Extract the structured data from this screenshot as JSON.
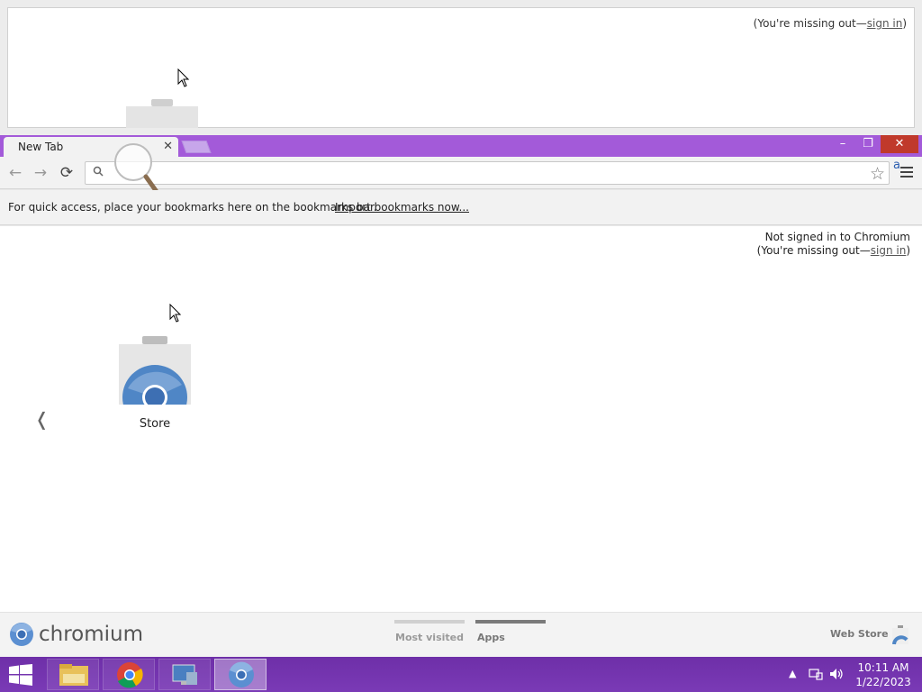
{
  "background_window": {
    "missing_out": "(You're missing out—",
    "sign_in": "sign in",
    "close_paren": ")"
  },
  "tab": {
    "title": "New Tab",
    "close": "✕"
  },
  "window_controls": {
    "minimize": "–",
    "restore": "❐",
    "close": "✕"
  },
  "toolbar": {
    "back": "←",
    "forward": "→",
    "reload": "⟳",
    "omnibox_value": "",
    "star": "☆",
    "extension_letter": "a"
  },
  "bookmarks_bar": {
    "prompt": "For quick access, place your bookmarks here on the bookmarks bar.",
    "import_link": "Import bookmarks now..."
  },
  "ntp": {
    "signin_status": "Not signed in to Chromium",
    "missing_out": "(You're missing out—",
    "sign_in": "sign in",
    "close_paren": ")",
    "prev_arrow": "❬",
    "apps": [
      {
        "label": "Store"
      }
    ]
  },
  "footer": {
    "brand": "chromium",
    "pages": [
      {
        "label": "Most visited",
        "active": false
      },
      {
        "label": "Apps",
        "active": true
      }
    ],
    "web_store": "Web Store"
  },
  "taskbar": {
    "clock_time": "10:11 AM",
    "clock_date": "1/22/2023",
    "tray_up": "▲"
  },
  "colors": {
    "tabstrip": "#a35ad9",
    "taskbar": "#7035ab",
    "close_button": "#c0392b"
  }
}
